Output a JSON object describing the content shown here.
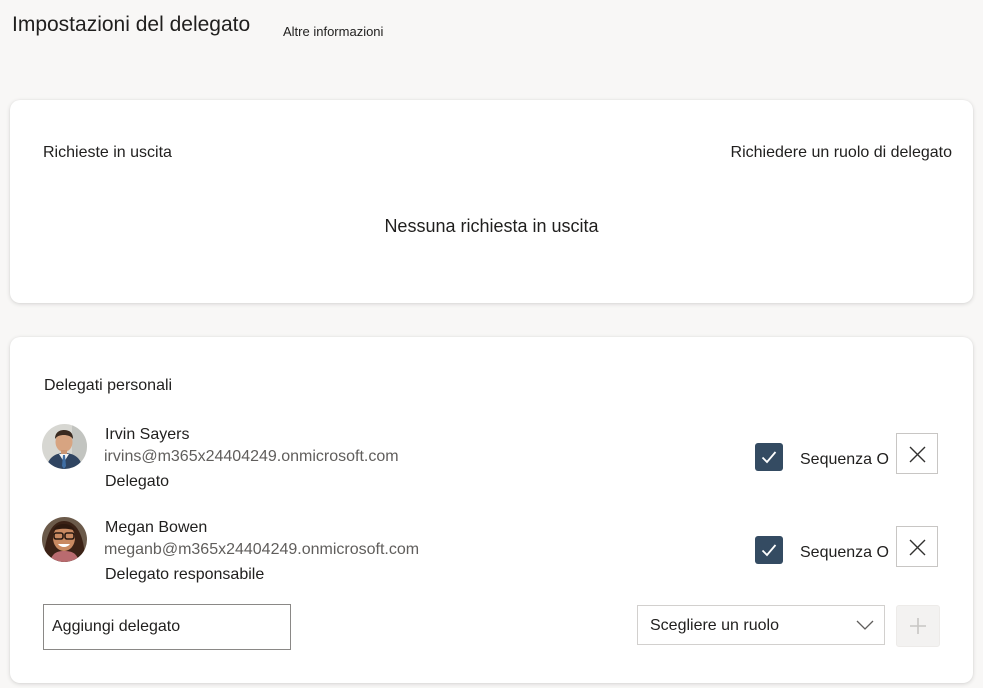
{
  "header": {
    "title": "Impostazioni del delegato",
    "more_info": "Altre informazioni"
  },
  "requests": {
    "label": "Richieste in uscita",
    "request_role_link": "Richiedere un ruolo di delegato",
    "empty_text": "Nessuna richiesta in uscita"
  },
  "delegates": {
    "label": "Delegati personali",
    "items": [
      {
        "name": "Irvin Sayers",
        "email": "irvins@m365x24404249.onmicrosoft.com",
        "role": "Delegato",
        "checked": true,
        "checkbox_label": "Sequenza O"
      },
      {
        "name": "Megan Bowen",
        "email": "meganb@m365x24404249.onmicrosoft.com",
        "role": "Delegato responsabile",
        "checked": true,
        "checkbox_label": "Sequenza O"
      }
    ],
    "add_input_value": "Aggiungi delegato",
    "role_select_value": "Scegliere un ruolo"
  },
  "icons": {
    "checkmark": "checkmark-icon",
    "close": "close-icon",
    "chevron": "chevron-down-icon",
    "add": "plus-icon"
  },
  "colors": {
    "checkbox_fill": "#344b62",
    "background": "#f8f7f6",
    "card": "#ffffff"
  }
}
